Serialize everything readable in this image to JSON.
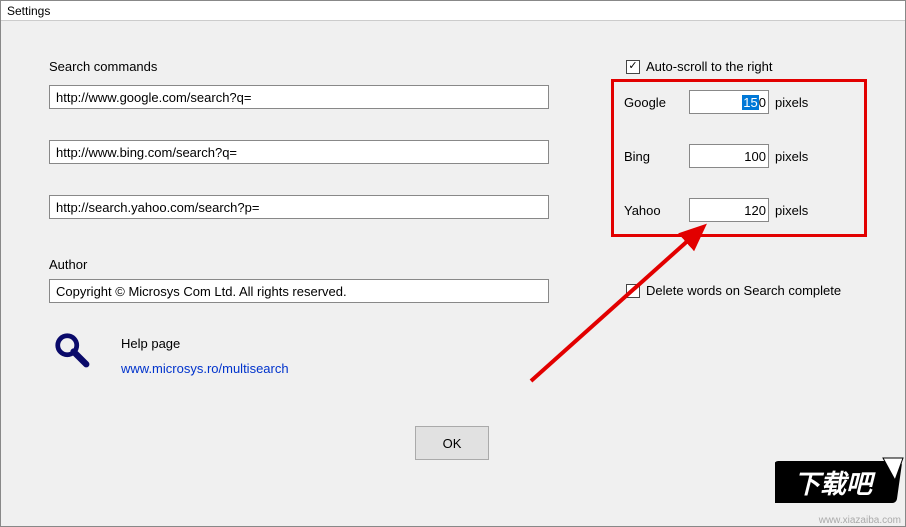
{
  "window_title": "Settings",
  "labels": {
    "search_commands": "Search commands",
    "author": "Author",
    "help_page": "Help page"
  },
  "search_urls": {
    "google": "http://www.google.com/search?q=",
    "bing": "http://www.bing.com/search?q=",
    "yahoo": "http://search.yahoo.com/search?p="
  },
  "author_value": "Copyright © Microsys Com Ltd. All rights reserved.",
  "help_link": "www.microsys.ro/multisearch",
  "checkboxes": {
    "auto_scroll": "Auto-scroll to the right",
    "delete_words": "Delete words on Search complete"
  },
  "pixel_rows": {
    "google": {
      "label": "Google",
      "value_selected": "15",
      "value_trail": "0",
      "unit": "pixels"
    },
    "bing": {
      "label": "Bing",
      "value": "100",
      "unit": "pixels"
    },
    "yahoo": {
      "label": "Yahoo",
      "value": "120",
      "unit": "pixels"
    }
  },
  "ok_button": "OK",
  "watermark": {
    "text": "下载吧",
    "url": "www.xiazaiba.com"
  }
}
